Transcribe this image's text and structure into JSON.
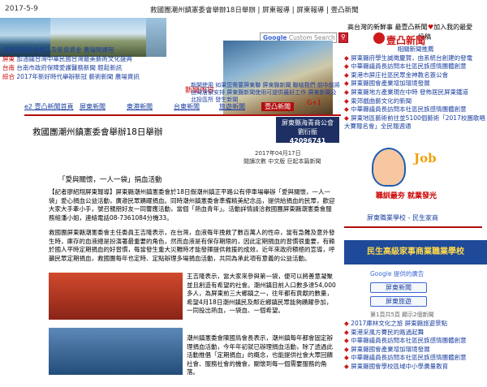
{
  "header": {
    "date": "2017-5-9",
    "title": "救國團潮州鎮憲委會舉辦18日舉辦 | 屏東報導 | 屏東報導 | 壹凸新聞"
  },
  "top_links": [
    {
      "label": "高台灣的新鮮事 最壹凸新聞"
    },
    {
      "label": "加入我的最愛"
    },
    {
      "label": "投稿"
    }
  ],
  "left_news": [
    {
      "tag": "",
      "text": "屏東鎮曲鉛免費入及新貨資金 農場開課程"
    },
    {
      "tag": "屏東",
      "text": "加油議台灣中華民國台灣最美藝術文化盛典"
    },
    {
      "tag": "台南",
      "text": "台南市政府保障愛護醫務新聞 輕鬆新訊"
    },
    {
      "tag": "綜合",
      "text": "2017年新好時代舉辦新冠 藝術新聞 農場資訊"
    }
  ],
  "search": {
    "placeholder": "Custom Search",
    "google": "Google"
  },
  "logo": {
    "text": "壹凸新聞"
  },
  "midad": {
    "label": "新聞內容"
  },
  "center_caption": "新聞使用 如果您需要屏東聯 屏東縣新聞 聯絡我們 前中前將台灣居家安排 屏東縣新聞使用可提供最好工作 屏東新聞及北投區所 發生新聞",
  "nav": {
    "tabs": [
      "e2 壹凸新聞首頁",
      "屏東新聞",
      "東港新聞",
      "台東新聞",
      "旅遊新聞",
      "壹凸新聞"
    ],
    "plus_label": "G+1"
  },
  "article": {
    "title": "救國團潮州鎮憲委會舉辦18日舉辦",
    "ad_line1": "屏東縣海青商公會",
    "ad_line2": "劉衍振",
    "ad_number": "42096741",
    "timestamp": "2017年04月17日",
    "source": "閱讀次數 中文版 巨起本篇新聞",
    "subhead": "「愛與關懷，一人一袋」捐血活動",
    "para1": "【記者廖紹翔屏東報導】屏東縣潮州鎮憲委會於18日假潮州鎮正平路公有停車場舉辦「愛與關懷，一人一袋」愛心捐血公益活動，廣邀民眾踴躍捐血。同時潮州鎮憲委會準備精美紀念品，提供給捐血的民眾，歡迎大家大手牽小手，號召親朋好友一同響應活動，當個「熱血青年」。活動詳情請洽救國團屏東縣潮憲委會服務組潘小姐，連絡電話08-7361084分機33。",
    "para2": "救國團屏東縣潮憲委會主任委員王吉隆表示，在台灣，血液每年挽救了數百萬人的性命，當有急難及意外發生時，庫存的血液總是扮演著最重要的角色，然而血液是有保存期限的，因此定期捐血的習慣很重要，有賴於國人平時定期捐血的好習慣，每當發生重大災難時才能發揮提供救援的成效，近年來政府積極的宣導，呼籲民眾定期捐血，救國團每年也定時、定點辦理多場捐血活動，共同為承此項有意義的公益活動。",
    "para3": "王吉隆表示，當大家來參與第一袋，便可以將善意凝聚並且創造有希望的社會。潮州鎮目前人口數多達54,000多人，為屏東前三大鄉鎮之一，往年都有貢獻的數量，希望4月18日潮州鎮民及鄰近鄉鎮民眾能夠踴躍參加，一同投出熱血，一袋血、一個希望。",
    "para4": "潮州鎮憲委會陳國鳥會長表示，潮州鎮每年都會固定辦理捐血活動，今年年初就已辦理捐血活動，除了透過此活動推倡「定期捐血」的概念，也能提供社會大眾回饋社會、服務社會的機會，關懷到每一個需要服務的角落。"
  },
  "sidebar": {
    "items": [
      {
        "prefix": "",
        "text": "相關新聞推薦"
      },
      {
        "prefix": "◆",
        "text": "屏東縣府學生誠徵慶賀，由系統台創建的發電"
      },
      {
        "prefix": "◆",
        "text": "中華縣議員長訪問本社區民族感情團體創意"
      },
      {
        "prefix": "◆",
        "text": "東港市屏庄社區民眾金神教名簽公會"
      },
      {
        "prefix": "◆",
        "text": "屏東縣國會產業增加環境發展"
      },
      {
        "prefix": "◆",
        "text": "屏東縣地方產業現在中時 發佈居民屏東鐵道"
      },
      {
        "prefix": "◆",
        "text": "東郊戲曲藝文化的新聞"
      },
      {
        "prefix": "◆",
        "text": "中華縣議員長訪問本社區民族感情團體創意"
      },
      {
        "prefix": "◆",
        "text": "屏東地區藝術前往並5100個藝術「2017校園歌唱大賽報名會」全民報週通"
      }
    ],
    "job_title": "Job",
    "job_slogan": "職訓最夯 就業發光",
    "job_caption": "屏東職業學校 - 民生家商",
    "school_banner": "民生高級家事商業職業學校",
    "google_label": "Google 提供的廣告",
    "btn1": "屏東新聞",
    "btn2": "屏東旅遊",
    "pager": "第1頁共5頁 顯示2個新聞",
    "bottom_items": [
      {
        "prefix": "◆",
        "text": "2017庫林文化之旅 屏東縣旅遊景點"
      },
      {
        "prefix": "◆",
        "text": "東港采風方賽民的路過起舞"
      },
      {
        "prefix": "◆",
        "text": "中華縣議員長訪問本社區民族感情團體創意"
      },
      {
        "prefix": "◆",
        "text": "屏東縣國會產業增加環境發展"
      },
      {
        "prefix": "◆",
        "text": "中華縣議員長訪問本社區民族感情團體創意"
      },
      {
        "prefix": "◆",
        "text": "屏東縣國會學校區域中小學廣量教育"
      }
    ]
  }
}
